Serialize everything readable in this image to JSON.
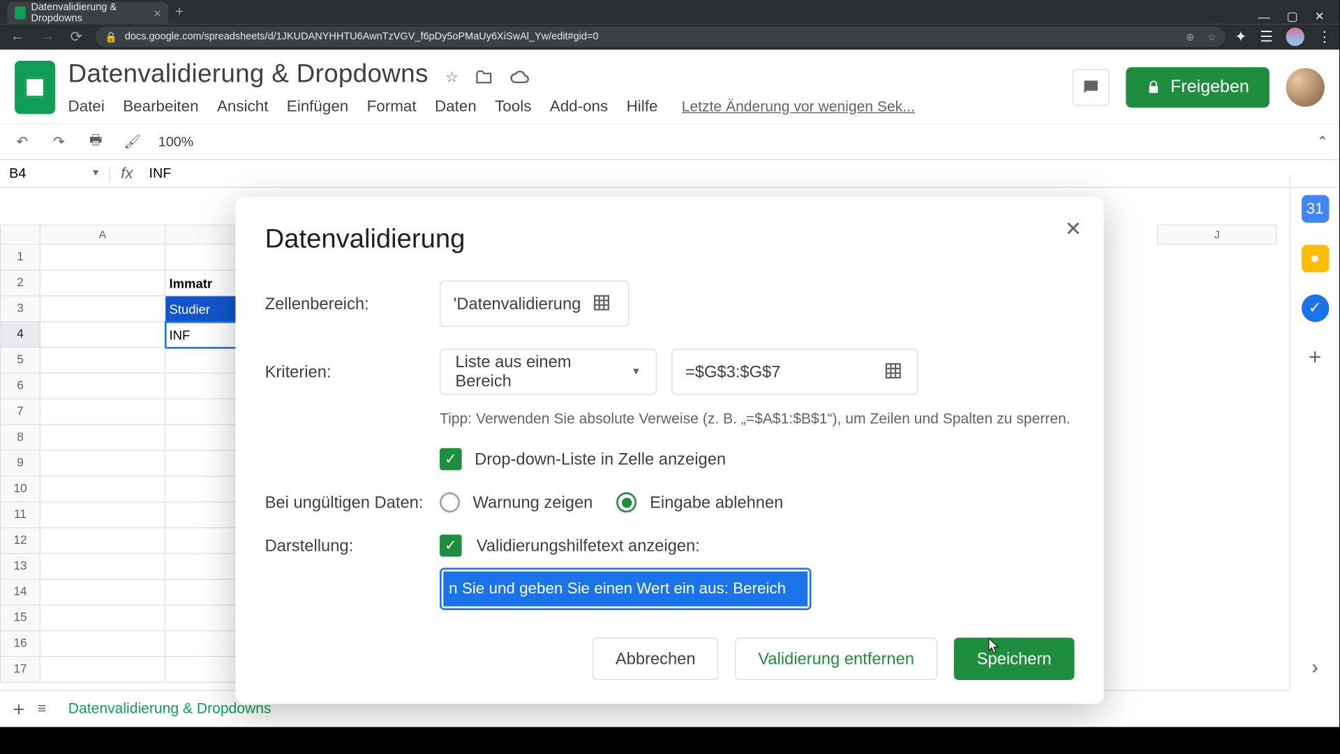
{
  "browser": {
    "tab_title": "Datenvalidierung & Dropdowns",
    "url": "docs.google.com/spreadsheets/d/1JKUDANYHHTU6AwnTzVGV_f6pDy5oPMaUy6XiSwAl_Yw/edit#gid=0"
  },
  "app": {
    "doc_title": "Datenvalidierung & Dropdowns",
    "share_label": "Freigeben",
    "last_edit": "Letzte Änderung vor wenigen Sek...",
    "menu": {
      "file": "Datei",
      "edit": "Bearbeiten",
      "view": "Ansicht",
      "insert": "Einfügen",
      "format": "Format",
      "data": "Daten",
      "tools": "Tools",
      "addons": "Add-ons",
      "help": "Hilfe"
    },
    "toolbar": {
      "zoom": "100%"
    },
    "namebox": "B4",
    "formula": "INF",
    "columns": {
      "A": "A",
      "J": "J"
    },
    "rows": [
      "1",
      "2",
      "3",
      "4",
      "5",
      "6",
      "7",
      "8",
      "9",
      "10",
      "11",
      "12",
      "13",
      "14",
      "15",
      "16",
      "17"
    ],
    "cells": {
      "B2": "Immatr",
      "B3": "Studier",
      "B4": "INF"
    },
    "sheet_tab": "Datenvalidierung & Dropdowns"
  },
  "dialog": {
    "title": "Datenvalidierung",
    "range_label": "Zellenbereich:",
    "range_value": "'Datenvalidierung",
    "criteria_label": "Kriterien:",
    "criteria_type": "Liste aus einem Bereich",
    "criteria_range": "=$G$3:$G$7",
    "tip": "Tipp: Verwenden Sie absolute Verweise (z. B. „=$A$1:$B$1“), um Zeilen und Spalten zu sperren.",
    "show_dropdown": "Drop-down-Liste in Zelle anzeigen",
    "invalid_label": "Bei ungültigen Daten:",
    "invalid_warn": "Warnung zeigen",
    "invalid_reject": "Eingabe ablehnen",
    "appearance_label": "Darstellung:",
    "show_help": "Validierungshilfetext anzeigen:",
    "help_text": "n Sie und geben Sie einen Wert ein aus: Bereich",
    "cancel": "Abbrechen",
    "remove": "Validierung entfernen",
    "save": "Speichern"
  }
}
